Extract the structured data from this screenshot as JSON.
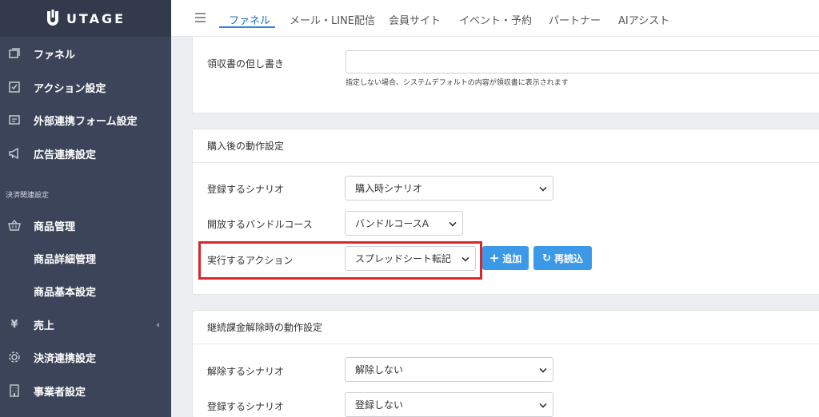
{
  "brand": {
    "name": "UTAGE"
  },
  "sidebar": {
    "items": [
      {
        "label": "ファネル",
        "icon": "funnel-icon"
      },
      {
        "label": "アクション設定",
        "icon": "check-square-icon"
      },
      {
        "label": "外部連携フォーム設定",
        "icon": "form-icon"
      },
      {
        "label": "広告連携設定",
        "icon": "megaphone-icon"
      }
    ],
    "section_caption": "決済関連設定",
    "payment_items": [
      {
        "label": "商品管理",
        "icon": "basket-icon"
      },
      {
        "label": "商品詳細管理"
      },
      {
        "label": "商品基本設定"
      },
      {
        "label": "売上",
        "icon": "yen-icon",
        "glyph": "¥"
      },
      {
        "label": "決済連携設定",
        "icon": "gear-icon"
      },
      {
        "label": "事業者設定",
        "icon": "building-icon"
      }
    ]
  },
  "topnav": {
    "tabs": [
      {
        "label": "ファネル",
        "active": true
      },
      {
        "label": "メール・LINE配信"
      },
      {
        "label": "会員サイト"
      },
      {
        "label": "イベント・予約"
      },
      {
        "label": "パートナー"
      },
      {
        "label": "AIアシスト"
      }
    ]
  },
  "receipt": {
    "label": "領収書の但し書き",
    "value": "",
    "help": "指定しない場合、システムデフォルトの内容が領収書に表示されます"
  },
  "post_purchase": {
    "title": "購入後の動作設定",
    "scenario": {
      "label": "登録するシナリオ",
      "value": "購入時シナリオ"
    },
    "bundle": {
      "label": "開放するバンドルコース",
      "value": "バンドルコースA"
    },
    "action": {
      "label": "実行するアクション",
      "value": "スプレッドシート転記"
    },
    "add_button": "追加",
    "reload_button": "再読込"
  },
  "cancel_section": {
    "title": "継続課金解除時の動作設定",
    "remove_scenario": {
      "label": "解除するシナリオ",
      "value": "解除しない"
    },
    "register_scenario": {
      "label": "登録するシナリオ",
      "value": "登録しない"
    }
  },
  "colors": {
    "sidebar_bg": "#3b4458",
    "accent": "#2f86d6",
    "button": "#3c99e8",
    "highlight": "#d9262c"
  }
}
